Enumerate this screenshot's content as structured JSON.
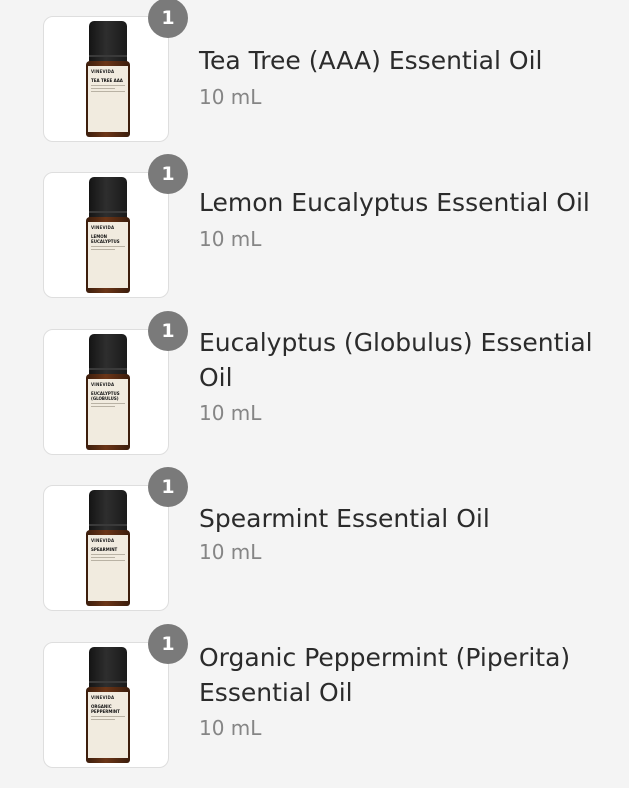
{
  "cart": {
    "items": [
      {
        "name": "Tea Tree (AAA) Essential Oil",
        "size": "10 mL",
        "quantity": "1",
        "bottle_label": {
          "brand": "VINEVIDA",
          "name": "TEA TREE AAA"
        }
      },
      {
        "name": "Lemon Eucalyptus Essential Oil",
        "size": "10 mL",
        "quantity": "1",
        "bottle_label": {
          "brand": "VINEVIDA",
          "name": "LEMON\nEUCALYPTUS"
        }
      },
      {
        "name": "Eucalyptus (Globulus) Essential Oil",
        "size": "10 mL",
        "quantity": "1",
        "bottle_label": {
          "brand": "VINEVIDA",
          "name": "EUCALYPTUS\n(GLOBULUS)"
        }
      },
      {
        "name": "Spearmint Essential Oil",
        "size": "10 mL",
        "quantity": "1",
        "bottle_label": {
          "brand": "VINEVIDA",
          "name": "SPEARMINT"
        }
      },
      {
        "name": "Organic Peppermint (Piperita) Essential Oil",
        "size": "10 mL",
        "quantity": "1",
        "bottle_label": {
          "brand": "VINEVIDA",
          "name": "ORGANIC\nPEPPERMINT"
        }
      }
    ]
  },
  "colors": {
    "background": "#f4f4f4",
    "badge": "#7a7a7a",
    "title_text": "#2b2b2b",
    "size_text": "#858585"
  },
  "icons": {
    "product_image": "essential-oil-bottle-icon"
  }
}
